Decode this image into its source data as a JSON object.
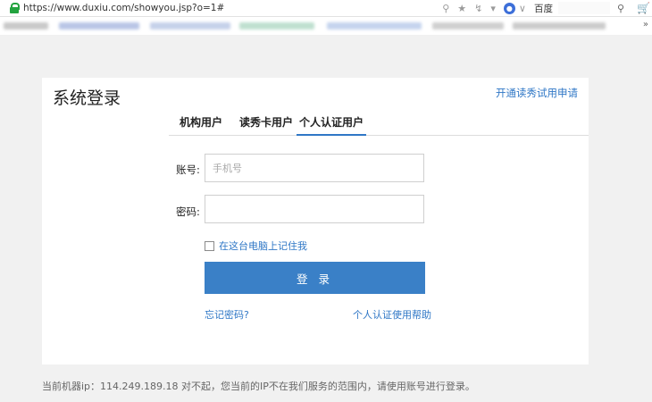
{
  "browser": {
    "url": "https://www.duxiu.com/showyou.jsp?o=1#",
    "search_engine": "百度",
    "icon_lock": "lock-icon"
  },
  "login": {
    "title": "系统登录",
    "trial_link": "开通读秀试用申请",
    "tabs": [
      {
        "label": "机构用户"
      },
      {
        "label": "读秀卡用户"
      },
      {
        "label": "个人认证用户"
      }
    ],
    "active_tab": "个人认证用户",
    "account_label": "账号:",
    "account_placeholder": "手机号",
    "password_label": "密码:",
    "remember_label": "在这台电脑上记住我",
    "login_button": "登 录",
    "forgot_link": "忘记密码?",
    "help_link": "个人认证使用帮助"
  },
  "footer": {
    "note": "当前机器ip：114.249.189.18  对不起，您当前的IP不在我们服务的范围内，请使用账号进行登录。"
  },
  "colors": {
    "accent": "#2f77c6",
    "button": "#3a80c7",
    "page_bg": "#f1f1f1"
  }
}
